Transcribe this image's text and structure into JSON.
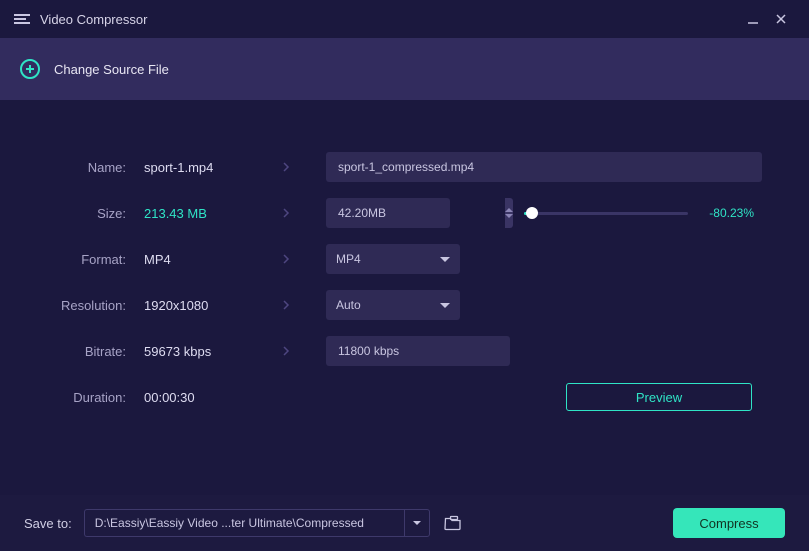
{
  "app": {
    "title": "Video Compressor"
  },
  "sourcebar": {
    "label": "Change Source File"
  },
  "rows": {
    "name_label": "Name:",
    "name_value": "sport-1.mp4",
    "name_output": "sport-1_compressed.mp4",
    "size_label": "Size:",
    "size_value": "213.43 MB",
    "size_output": "42.20MB",
    "size_pct": "-80.23%",
    "format_label": "Format:",
    "format_value": "MP4",
    "format_output": "MP4",
    "resolution_label": "Resolution:",
    "resolution_value": "1920x1080",
    "resolution_output": "Auto",
    "bitrate_label": "Bitrate:",
    "bitrate_value": "59673 kbps",
    "bitrate_output": "11800 kbps",
    "duration_label": "Duration:",
    "duration_value": "00:00:30"
  },
  "preview": {
    "label": "Preview"
  },
  "footer": {
    "save_label": "Save to:",
    "path": "D:\\Eassiy\\Eassiy Video ...ter Ultimate\\Compressed",
    "compress_label": "Compress"
  }
}
